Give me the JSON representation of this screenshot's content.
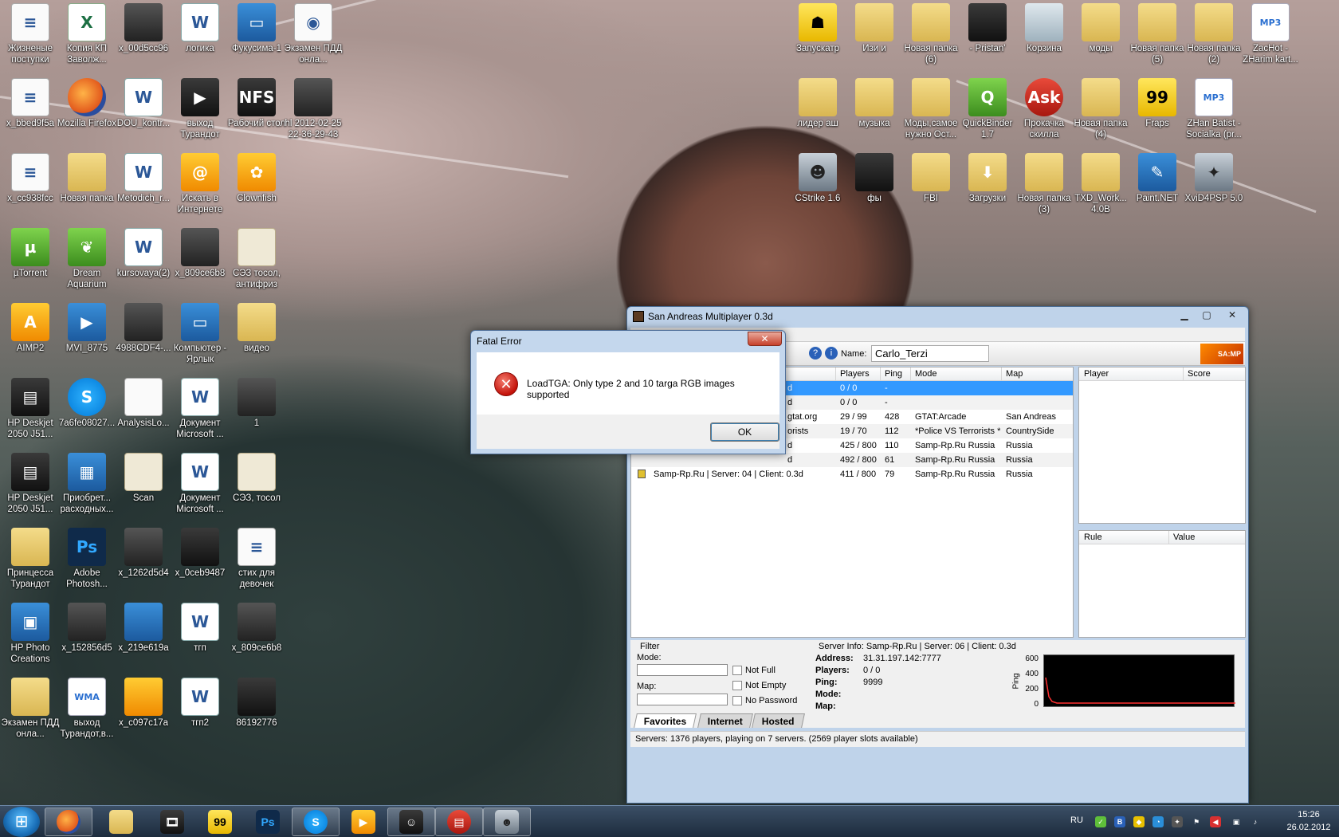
{
  "desktop": {
    "icons_left": [
      {
        "label": "Жизненые поступки",
        "kind": "i-doc",
        "glyph": "≡",
        "icon": "text-file-icon"
      },
      {
        "label": "Копия КП Заволж...",
        "kind": "i-excel",
        "glyph": "X",
        "icon": "excel-file-icon"
      },
      {
        "label": "x_00d5cc96",
        "kind": "i-photo",
        "glyph": "",
        "icon": "image-file-icon"
      },
      {
        "label": "логика",
        "kind": "i-word",
        "glyph": "W",
        "icon": "word-file-icon"
      },
      {
        "label": "Фукусима-1",
        "kind": "i-blue",
        "glyph": "▭",
        "icon": "presentation-file-icon"
      },
      {
        "label": "Экзамен ПДД онла...",
        "kind": "i-doc",
        "glyph": "◉",
        "icon": "firefox-page-icon"
      },
      {
        "label": "x_bbed9f5a",
        "kind": "i-doc",
        "glyph": "≡",
        "icon": "text-file-icon"
      },
      {
        "label": "Mozilla Firefox",
        "kind": "i-ff",
        "glyph": "",
        "icon": "firefox-icon"
      },
      {
        "label": "DOU_kontr...",
        "kind": "i-word",
        "glyph": "W",
        "icon": "word-file-icon"
      },
      {
        "label": "выход Турандот",
        "kind": "i-dark",
        "glyph": "▶",
        "icon": "video-file-icon"
      },
      {
        "label": "Рабочий стол",
        "kind": "i-dark",
        "glyph": "NFS",
        "icon": "shortcut-icon"
      },
      {
        "label": "hl 2012-02-25 22-36-29-43",
        "kind": "i-photo",
        "glyph": "",
        "icon": "screenshot-file-icon"
      },
      {
        "label": "x_cc938fcc",
        "kind": "i-doc",
        "glyph": "≡",
        "icon": "text-file-icon"
      },
      {
        "label": "Новая папка",
        "kind": "i-folder",
        "glyph": "",
        "icon": "folder-icon"
      },
      {
        "label": "Metodich_r...",
        "kind": "i-word",
        "glyph": "W",
        "icon": "word-file-icon"
      },
      {
        "label": "Искать в Интернете",
        "kind": "i-orange",
        "glyph": "@",
        "icon": "search-internet-icon"
      },
      {
        "label": "Clownfish",
        "kind": "i-orange",
        "glyph": "✿",
        "icon": "clownfish-icon"
      },
      {
        "label": "",
        "kind": "",
        "glyph": "",
        "icon": ""
      },
      {
        "label": "µTorrent",
        "kind": "i-green",
        "glyph": "µ",
        "icon": "utorrent-icon"
      },
      {
        "label": "Dream Aquarium",
        "kind": "i-green",
        "glyph": "❦",
        "icon": "aquarium-icon"
      },
      {
        "label": "kursovaya(2)",
        "kind": "i-word",
        "glyph": "W",
        "icon": "word-file-icon"
      },
      {
        "label": "x_809ce6b8",
        "kind": "i-photo",
        "glyph": "",
        "icon": "image-file-icon"
      },
      {
        "label": "СЭЗ тосол, антифриз",
        "kind": "i-cert",
        "glyph": "",
        "icon": "scan-document-icon"
      },
      {
        "label": "",
        "kind": "",
        "glyph": "",
        "icon": ""
      },
      {
        "label": "AIMP2",
        "kind": "i-orange",
        "glyph": "A",
        "icon": "aimp-icon"
      },
      {
        "label": "MVI_8775",
        "kind": "i-blue",
        "glyph": "▶",
        "icon": "video-file-icon"
      },
      {
        "label": "4988CDF4-...",
        "kind": "i-photo",
        "glyph": "",
        "icon": "image-file-icon"
      },
      {
        "label": "Компьютер - Ярлык",
        "kind": "i-blue",
        "glyph": "▭",
        "icon": "computer-icon"
      },
      {
        "label": "видео",
        "kind": "i-folder",
        "glyph": "",
        "icon": "folder-icon"
      },
      {
        "label": "",
        "kind": "",
        "glyph": "",
        "icon": ""
      },
      {
        "label": "HP Deskjet 2050 J51...",
        "kind": "i-dark",
        "glyph": "▤",
        "icon": "scanner-icon"
      },
      {
        "label": "7a6fe08027...",
        "kind": "i-skype",
        "glyph": "S",
        "icon": "skype-file-icon"
      },
      {
        "label": "AnalysisLo...",
        "kind": "i-doc",
        "glyph": "",
        "icon": "blank-file-icon"
      },
      {
        "label": "Документ Microsoft ...",
        "kind": "i-word",
        "glyph": "W",
        "icon": "word-file-icon"
      },
      {
        "label": "1",
        "kind": "i-photo",
        "glyph": "",
        "icon": "image-file-icon"
      },
      {
        "label": "",
        "kind": "",
        "glyph": "",
        "icon": ""
      },
      {
        "label": "HP Deskjet 2050 J51...",
        "kind": "i-dark",
        "glyph": "▤",
        "icon": "printer-icon"
      },
      {
        "label": "Приобрет... расходных...",
        "kind": "i-blue",
        "glyph": "▦",
        "icon": "supplies-icon"
      },
      {
        "label": "Scan",
        "kind": "i-cert",
        "glyph": "",
        "icon": "book-icon"
      },
      {
        "label": "Документ Microsoft ...",
        "kind": "i-word",
        "glyph": "W",
        "icon": "word-file-icon"
      },
      {
        "label": "СЭЗ, тосол",
        "kind": "i-cert",
        "glyph": "",
        "icon": "scan-document-icon"
      },
      {
        "label": "",
        "kind": "",
        "glyph": "",
        "icon": ""
      },
      {
        "label": "Принцесса Турандот",
        "kind": "i-folder",
        "glyph": "",
        "icon": "folder-icon"
      },
      {
        "label": "Adobe Photosh...",
        "kind": "i-ps",
        "glyph": "Ps",
        "icon": "photoshop-icon"
      },
      {
        "label": "x_1262d5d4",
        "kind": "i-photo",
        "glyph": "",
        "icon": "image-file-icon"
      },
      {
        "label": "x_0ceb9487",
        "kind": "i-dark",
        "glyph": "",
        "icon": "apple-image-icon"
      },
      {
        "label": "стих для девочек",
        "kind": "i-doc",
        "glyph": "≡",
        "icon": "text-file-icon"
      },
      {
        "label": "",
        "kind": "",
        "glyph": "",
        "icon": ""
      },
      {
        "label": "HP Photo Creations",
        "kind": "i-blue",
        "glyph": "▣",
        "icon": "hp-photo-icon"
      },
      {
        "label": "x_152856d5",
        "kind": "i-photo",
        "glyph": "",
        "icon": "image-file-icon"
      },
      {
        "label": "x_219e619a",
        "kind": "i-blue",
        "glyph": "",
        "icon": "image-file-icon"
      },
      {
        "label": "тгп",
        "kind": "i-word",
        "glyph": "W",
        "icon": "word-file-icon"
      },
      {
        "label": "x_809ce6b8",
        "kind": "i-photo",
        "glyph": "",
        "icon": "image-file-icon"
      },
      {
        "label": "",
        "kind": "",
        "glyph": "",
        "icon": ""
      },
      {
        "label": "Экзамен ПДД онла...",
        "kind": "i-folder",
        "glyph": "",
        "icon": "folder-icon"
      },
      {
        "label": "выход Турандот,в...",
        "kind": "i-mp3",
        "glyph": "WMA",
        "icon": "audio-file-icon"
      },
      {
        "label": "x_c097c17a",
        "kind": "i-orange",
        "glyph": "",
        "icon": "image-file-icon"
      },
      {
        "label": "тгп2",
        "kind": "i-word",
        "glyph": "W",
        "icon": "word-file-icon"
      },
      {
        "label": "86192776",
        "kind": "i-dark",
        "glyph": "",
        "icon": "image-file-icon"
      }
    ],
    "icons_right": [
      {
        "label": "Запускатр",
        "kind": "i-yellow",
        "glyph": "☗",
        "icon": "launcher-icon"
      },
      {
        "label": "Изи и",
        "kind": "i-folder",
        "glyph": "",
        "icon": "folder-icon"
      },
      {
        "label": "Новая папка (6)",
        "kind": "i-folder",
        "glyph": "",
        "icon": "folder-icon"
      },
      {
        "label": "- Pristan'",
        "kind": "i-dark",
        "glyph": "",
        "icon": "video-file-icon"
      },
      {
        "label": "Корзина",
        "kind": "i-bin",
        "glyph": "",
        "icon": "recycle-bin-icon"
      },
      {
        "label": "моды",
        "kind": "i-folder",
        "glyph": "",
        "icon": "folder-icon"
      },
      {
        "label": "Новая папка (5)",
        "kind": "i-folder",
        "glyph": "",
        "icon": "folder-icon"
      },
      {
        "label": "Новая папка (2)",
        "kind": "i-folder",
        "glyph": "",
        "icon": "folder-icon"
      },
      {
        "label": "ZacHot - ZHarim kart...",
        "kind": "i-mp3",
        "glyph": "MP3",
        "icon": "mp3-file-icon"
      },
      {
        "label": "лидер аш",
        "kind": "i-folder",
        "glyph": "",
        "icon": "folder-icon"
      },
      {
        "label": "музыка",
        "kind": "i-folder",
        "glyph": "",
        "icon": "folder-icon"
      },
      {
        "label": "Моды,самое нужно Ост...",
        "kind": "i-folder",
        "glyph": "",
        "icon": "folder-icon"
      },
      {
        "label": "QuickBinder 1.7",
        "kind": "i-green",
        "glyph": "Q",
        "icon": "quickbinder-icon"
      },
      {
        "label": "Прокачка скилла",
        "kind": "i-red",
        "glyph": "Ask",
        "icon": "ask-icon"
      },
      {
        "label": "Новая папка (4)",
        "kind": "i-folder",
        "glyph": "",
        "icon": "folder-icon"
      },
      {
        "label": "Fraps",
        "kind": "i-yellow",
        "glyph": "99",
        "icon": "fraps-icon"
      },
      {
        "label": "ZHan Batist - Socialka (pr...",
        "kind": "i-mp3",
        "glyph": "MP3",
        "icon": "mp3-file-icon"
      },
      {
        "label": "",
        "kind": "",
        "glyph": "",
        "icon": ""
      },
      {
        "label": "CStrike 1.6",
        "kind": "i-cs",
        "glyph": "☻",
        "icon": "counter-strike-icon"
      },
      {
        "label": "фы",
        "kind": "i-dark",
        "glyph": "",
        "icon": "image-file-icon"
      },
      {
        "label": "FBI",
        "kind": "i-folder",
        "glyph": "",
        "icon": "folder-icon"
      },
      {
        "label": "Загрузки",
        "kind": "i-folder",
        "glyph": "⬇",
        "icon": "downloads-folder-icon"
      },
      {
        "label": "Новая папка (3)",
        "kind": "i-folder",
        "glyph": "",
        "icon": "folder-icon"
      },
      {
        "label": "TXD_Work... 4.0B",
        "kind": "i-folder",
        "glyph": "",
        "icon": "folder-icon"
      },
      {
        "label": "Paint.NET",
        "kind": "i-blue",
        "glyph": "✎",
        "icon": "paint-net-icon"
      },
      {
        "label": "XviD4PSP 5.0",
        "kind": "i-cs",
        "glyph": "✦",
        "icon": "xvid-icon"
      }
    ]
  },
  "samp": {
    "title": "San Andreas Multiplayer 0.3d",
    "name_label": "Name:",
    "name_value": "Carlo_Terzi",
    "logo": "SA:MP",
    "list_headers": [
      "Players",
      "Ping",
      "Mode",
      "Map"
    ],
    "rows": [
      {
        "name": "d",
        "players": "0 / 0",
        "ping": "-",
        "mode": "",
        "map": "",
        "selected": true
      },
      {
        "name": "d",
        "players": "0 / 0",
        "ping": "-",
        "mode": "",
        "map": "",
        "selected": false
      },
      {
        "name": "gtat.org",
        "players": "29 / 99",
        "ping": "428",
        "mode": "GTAT:Arcade",
        "map": "San Andreas",
        "selected": false
      },
      {
        "name": "orists",
        "players": "19 / 70",
        "ping": "112",
        "mode": "*Police VS Terrorists *",
        "map": "CountrySide",
        "selected": false
      },
      {
        "name": "d",
        "players": "425 / 800",
        "ping": "110",
        "mode": "Samp-Rp.Ru Russia",
        "map": "Russia",
        "selected": false
      },
      {
        "name": "d",
        "players": "492 / 800",
        "ping": "61",
        "mode": "Samp-Rp.Ru Russia",
        "map": "Russia",
        "selected": false
      },
      {
        "name": "Samp-Rp.Ru | Server: 04 | Client: 0.3d",
        "players": "411 / 800",
        "ping": "79",
        "mode": "Samp-Rp.Ru Russia",
        "map": "Russia",
        "selected": false
      }
    ],
    "player_headers": [
      "Player",
      "Score"
    ],
    "rule_headers": [
      "Rule",
      "Value"
    ],
    "filter": {
      "title": "Filter",
      "mode_label": "Mode:",
      "map_label": "Map:",
      "not_full": "Not Full",
      "not_empty": "Not Empty",
      "no_password": "No Password"
    },
    "info": {
      "title": "Server Info: Samp-Rp.Ru | Server: 06 | Client: 0.3d",
      "address_label": "Address:",
      "address": "31.31.197.142:7777",
      "players_label": "Players:",
      "players": "0 / 0",
      "ping_label": "Ping:",
      "ping": "9999",
      "mode_label": "Mode:",
      "map_label": "Map:"
    },
    "ping_graph": {
      "axis_label": "Ping",
      "ticks": [
        "600",
        "400",
        "200",
        "0"
      ]
    },
    "tabs": [
      "Favorites",
      "Internet",
      "Hosted"
    ],
    "status": "Servers: 1376 players, playing on 7 servers. (2569 player slots available)"
  },
  "dialog": {
    "title": "Fatal Error",
    "close": "✕",
    "message": "LoadTGA: Only type 2 and 10 targa RGB images supported",
    "ok": "OK"
  },
  "taskbar": {
    "apps": [
      {
        "icon": "firefox-icon",
        "kind": "i-ff",
        "glyph": "",
        "open": true
      },
      {
        "icon": "explorer-icon",
        "kind": "i-folder",
        "glyph": "",
        "open": false
      },
      {
        "icon": "media-center-icon",
        "kind": "i-dark",
        "glyph": "🎞",
        "open": false
      },
      {
        "icon": "fraps-icon",
        "kind": "i-yellow",
        "glyph": "99",
        "open": false
      },
      {
        "icon": "photoshop-icon",
        "kind": "i-ps",
        "glyph": "Ps",
        "open": false
      },
      {
        "icon": "skype-icon",
        "kind": "i-skype",
        "glyph": "S",
        "open": true
      },
      {
        "icon": "media-player-icon",
        "kind": "i-orange",
        "glyph": "▶",
        "open": false
      },
      {
        "icon": "gta-sa-icon",
        "kind": "i-dark",
        "glyph": "☺",
        "open": true
      },
      {
        "icon": "winrar-icon",
        "kind": "i-red",
        "glyph": "▤",
        "open": true
      },
      {
        "icon": "counter-strike-icon",
        "kind": "i-cs",
        "glyph": "☻",
        "open": true
      }
    ],
    "lang": "RU",
    "time": "15:26",
    "date": "26.02.2012"
  }
}
